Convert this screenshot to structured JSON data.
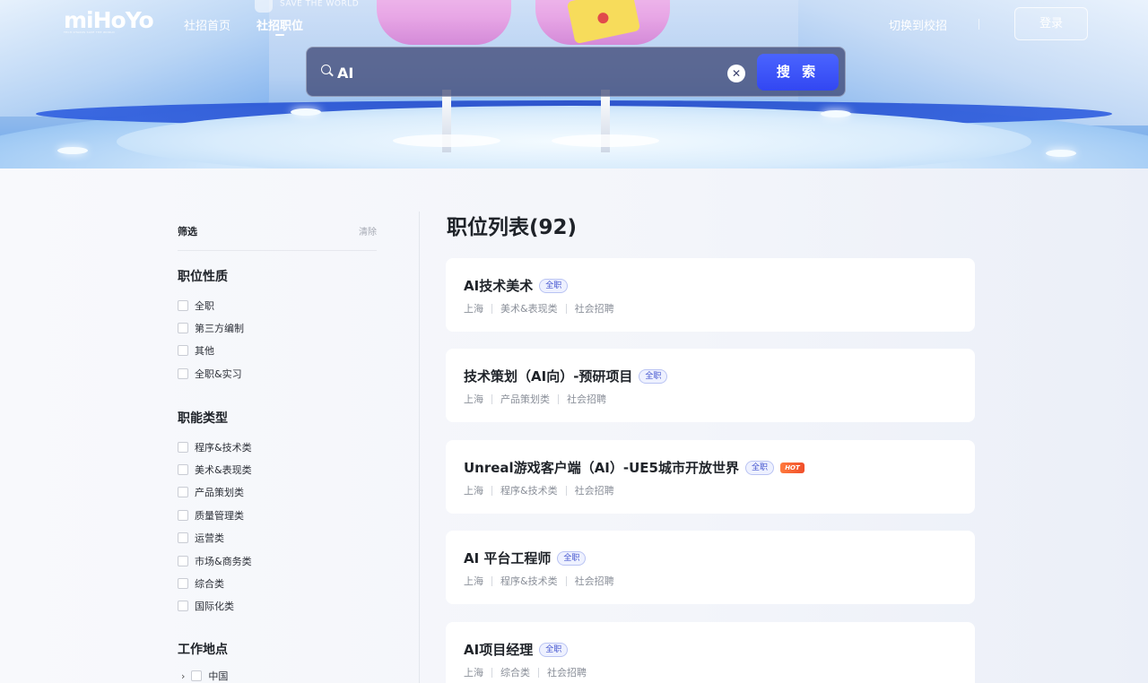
{
  "nav": {
    "logo_text": "miHoYo",
    "logo_sub": "TECH OTAKUS SAVE THE WORLD",
    "hero_badge": "SAVE THE WORLD",
    "home": "社招首页",
    "jobs": "社招职位",
    "campus": "切换到校招",
    "login": "登录"
  },
  "search": {
    "value": "AI",
    "clear_symbol": "✕",
    "button": "搜 索"
  },
  "filter": {
    "title": "筛选",
    "clear": "清除",
    "groups": [
      {
        "title": "职位性质",
        "options": [
          "全职",
          "第三方编制",
          "其他",
          "全职&实习"
        ]
      },
      {
        "title": "职能类型",
        "options": [
          "程序&技术类",
          "美术&表现类",
          "产品策划类",
          "质量管理类",
          "运营类",
          "市场&商务类",
          "综合类",
          "国际化类"
        ]
      },
      {
        "title": "工作地点",
        "options": [
          "中国"
        ]
      }
    ]
  },
  "list": {
    "title": "职位列表(92)",
    "jobs": [
      {
        "title": "AI技术美术",
        "tag": "全职",
        "hot": "",
        "city": "上海",
        "category": "美术&表现类",
        "type": "社会招聘"
      },
      {
        "title": "技术策划（AI向）-预研项目",
        "tag": "全职",
        "hot": "",
        "city": "上海",
        "category": "产品策划类",
        "type": "社会招聘"
      },
      {
        "title": "Unreal游戏客户端（AI）-UE5城市开放世界",
        "tag": "全职",
        "hot": "HOT",
        "city": "上海",
        "category": "程序&技术类",
        "type": "社会招聘"
      },
      {
        "title": "AI 平台工程师",
        "tag": "全职",
        "hot": "",
        "city": "上海",
        "category": "程序&技术类",
        "type": "社会招聘"
      },
      {
        "title": "AI项目经理",
        "tag": "全职",
        "hot": "",
        "city": "上海",
        "category": "综合类",
        "type": "社会招聘"
      }
    ]
  },
  "colors": {
    "accent": "#3247f2",
    "tag_text": "#4556cf",
    "hot": "#f04e2a"
  }
}
